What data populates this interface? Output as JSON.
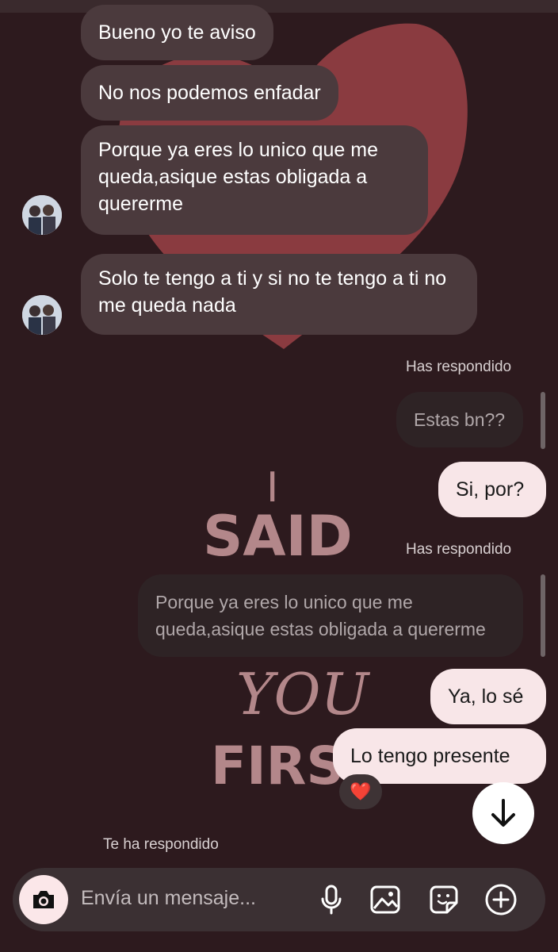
{
  "messages_in": [
    {
      "text": "Bueno yo te aviso"
    },
    {
      "text": "No nos podemos enfadar"
    },
    {
      "text": "Porque ya eres lo unico que me queda,asique estas obligada a quererme"
    },
    {
      "text": "Solo te tengo a ti y si no te tengo a ti no me queda nada"
    }
  ],
  "replies": [
    {
      "label": "Has respondido",
      "quoted": "Estas bn??",
      "answer": "Si, por?"
    },
    {
      "label": "Has respondido",
      "quoted": "Porque ya eres lo unico que me queda,asique estas obligada a quererme",
      "answer": "Ya, lo sé"
    }
  ],
  "last_message": {
    "text": "Lo tengo presente",
    "reaction": "❤️"
  },
  "footer_note": "Te ha respondido",
  "composer": {
    "placeholder": "Envía un mensaje..."
  },
  "background_text": {
    "line1": "I",
    "line2": "SAID",
    "line3": "YOU",
    "line4": "FIRST"
  },
  "colors": {
    "background": "#2d1a1e",
    "heart": "#8a3b40",
    "incoming_bubble": "#4b3a3d",
    "outgoing_bubble": "#f8e6e8"
  },
  "icons": [
    "camera-icon",
    "microphone-icon",
    "gallery-icon",
    "sticker-icon",
    "plus-icon",
    "arrow-down-icon"
  ]
}
